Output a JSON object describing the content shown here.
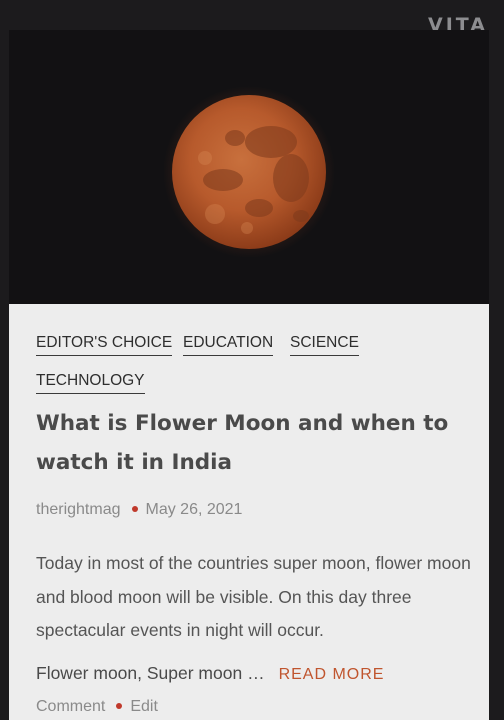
{
  "watermark": "VITA",
  "hero": {
    "image_name": "blood-moon-image"
  },
  "post": {
    "tags": [
      "EDITOR'S CHOICE",
      "EDUCATION",
      "SCIENCE",
      "TECHNOLOGY"
    ],
    "title": "What is Flower Moon and when to watch it in India",
    "author": "therightmag",
    "date": "May 26, 2021",
    "excerpt": "Today in most of the countries super moon, flower moon and blood moon will be visible. On this day three spectacular events in night will occur.",
    "excerpt_more": "Flower moon, Super moon …",
    "read_more": "READ MORE",
    "comment_label": "Comment",
    "edit_label": "Edit"
  },
  "colors": {
    "background": "#1c1b1d",
    "card": "#ededed",
    "accent": "#c0552e",
    "dot": "#c0392b"
  }
}
